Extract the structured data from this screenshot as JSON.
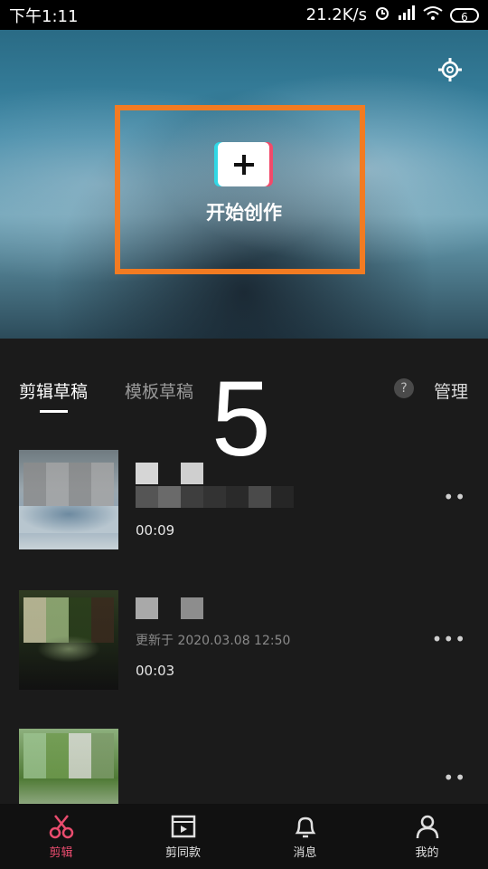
{
  "status_bar": {
    "time": "下午1:11",
    "speed": "21.2K/s",
    "battery": "6",
    "icons": [
      "alarm-icon",
      "signal-icon",
      "wifi-icon",
      "battery-icon"
    ]
  },
  "hero": {
    "create_label": "开始创作",
    "settings_icon": "settings-icon",
    "highlight_color": "#f27b22"
  },
  "overlay_number": "5",
  "tabs": {
    "active": "剪辑草稿",
    "inactive": "模板草稿",
    "help": "?",
    "manage": "管理"
  },
  "drafts": [
    {
      "title": "",
      "date": "",
      "duration": "00:09"
    },
    {
      "title": "",
      "date": "更新于 2020.03.08 12:50",
      "duration": "00:03"
    },
    {
      "title": "",
      "date": "",
      "duration": ""
    }
  ],
  "bottom_nav": [
    {
      "label": "剪辑",
      "icon": "scissors-icon",
      "active": true
    },
    {
      "label": "剪同款",
      "icon": "clapper-icon",
      "active": false
    },
    {
      "label": "消息",
      "icon": "bell-icon",
      "active": false
    },
    {
      "label": "我的",
      "icon": "user-icon",
      "active": false
    }
  ],
  "colors": {
    "accent": "#e94c6e",
    "create_cyan": "#31d7e5",
    "create_red": "#f24a6a",
    "background": "#1b1b1b"
  }
}
